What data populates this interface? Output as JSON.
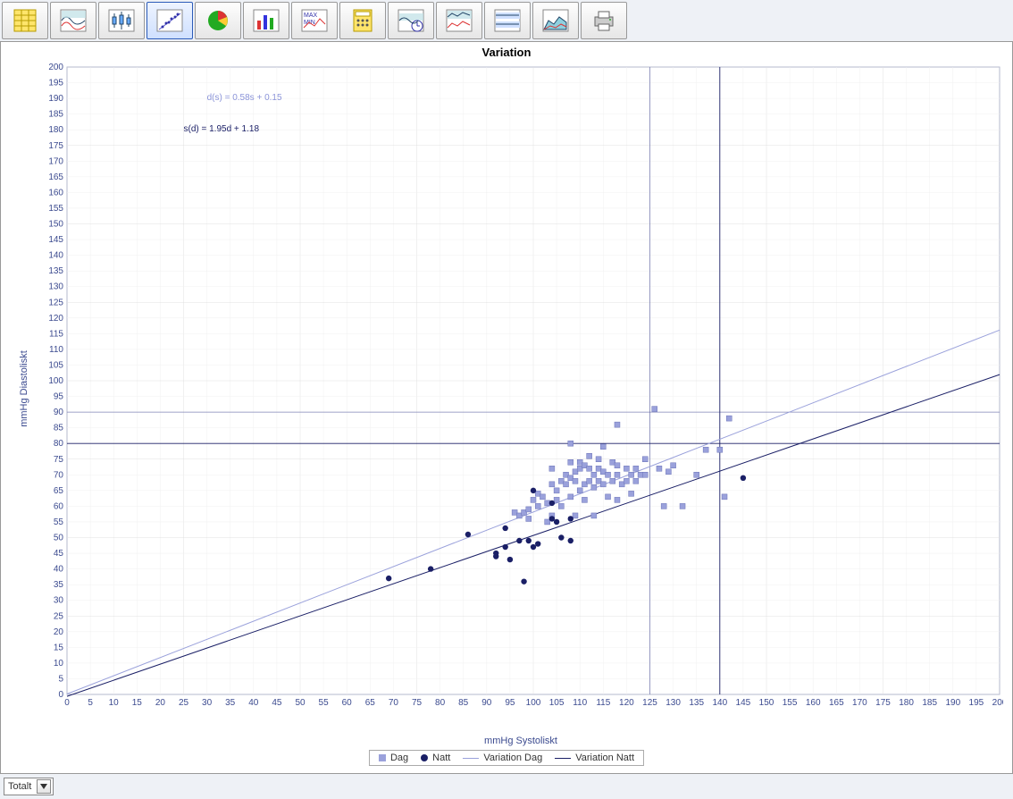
{
  "toolbar": {
    "active_index": 3,
    "buttons": [
      "spreadsheet-icon",
      "waves-icon",
      "box-plot-icon",
      "scatter-icon",
      "pie-icon",
      "bars-icon",
      "max-min-icon",
      "calculator-icon",
      "clock-icon",
      "multi-line-icon",
      "bands-icon",
      "area-icon",
      "printer-icon"
    ]
  },
  "chart_title": "Variation",
  "xlabel": "mmHg Systoliskt",
  "ylabel": "mmHg Diastoliskt",
  "annotation1": "d(s) = 0.58s + 0.15",
  "annotation2": "s(d) = 1.95d + 1.18",
  "legend": {
    "dag": "Dag",
    "natt": "Natt",
    "variation_dag": "Variation Dag",
    "variation_natt": "Variation Natt"
  },
  "bottom_selector": {
    "value": "Totalt"
  },
  "colors": {
    "dag": "#9aa1db",
    "natt": "#1a1f66",
    "line_dag": "#9aa1db",
    "line_natt": "#1a1f66",
    "grid_minor": "#f0f0f0",
    "grid_major": "#e0e0e0",
    "axis": "#3b4a8f",
    "ref": "#52589e"
  },
  "chart_data": {
    "type": "scatter",
    "title": "Variation",
    "xlabel": "mmHg Systoliskt",
    "ylabel": "mmHg Diastoliskt",
    "xlim": [
      0,
      200
    ],
    "ylim": [
      0,
      200
    ],
    "xticks_step": 5,
    "yticks_step": 5,
    "series": [
      {
        "name": "Dag",
        "marker": "square",
        "color": "#9aa1db",
        "points": [
          [
            96,
            58
          ],
          [
            97,
            57
          ],
          [
            98,
            58
          ],
          [
            99,
            56
          ],
          [
            99,
            59
          ],
          [
            100,
            62
          ],
          [
            101,
            64
          ],
          [
            101,
            60
          ],
          [
            102,
            63
          ],
          [
            103,
            55
          ],
          [
            103,
            61
          ],
          [
            104,
            57
          ],
          [
            104,
            67
          ],
          [
            104,
            72
          ],
          [
            105,
            62
          ],
          [
            105,
            65
          ],
          [
            106,
            60
          ],
          [
            106,
            68
          ],
          [
            107,
            67
          ],
          [
            107,
            70
          ],
          [
            108,
            63
          ],
          [
            108,
            69
          ],
          [
            108,
            74
          ],
          [
            108,
            80
          ],
          [
            109,
            57
          ],
          [
            109,
            68
          ],
          [
            109,
            71
          ],
          [
            110,
            65
          ],
          [
            110,
            72
          ],
          [
            110,
            74
          ],
          [
            111,
            62
          ],
          [
            111,
            67
          ],
          [
            111,
            73
          ],
          [
            112,
            68
          ],
          [
            112,
            72
          ],
          [
            112,
            76
          ],
          [
            113,
            57
          ],
          [
            113,
            66
          ],
          [
            113,
            70
          ],
          [
            114,
            68
          ],
          [
            114,
            72
          ],
          [
            114,
            75
          ],
          [
            115,
            67
          ],
          [
            115,
            71
          ],
          [
            115,
            79
          ],
          [
            116,
            63
          ],
          [
            116,
            70
          ],
          [
            117,
            68
          ],
          [
            117,
            74
          ],
          [
            118,
            62
          ],
          [
            118,
            70
          ],
          [
            118,
            73
          ],
          [
            118,
            86
          ],
          [
            119,
            67
          ],
          [
            120,
            68
          ],
          [
            120,
            72
          ],
          [
            121,
            64
          ],
          [
            121,
            70
          ],
          [
            122,
            68
          ],
          [
            122,
            72
          ],
          [
            123,
            70
          ],
          [
            124,
            70
          ],
          [
            124,
            75
          ],
          [
            126,
            91
          ],
          [
            127,
            72
          ],
          [
            128,
            60
          ],
          [
            129,
            71
          ],
          [
            130,
            73
          ],
          [
            132,
            60
          ],
          [
            135,
            70
          ],
          [
            137,
            78
          ],
          [
            140,
            78
          ],
          [
            141,
            63
          ],
          [
            142,
            88
          ]
        ]
      },
      {
        "name": "Natt",
        "marker": "circle",
        "color": "#1a1f66",
        "points": [
          [
            69,
            37
          ],
          [
            78,
            40
          ],
          [
            86,
            51
          ],
          [
            92,
            45
          ],
          [
            92,
            44
          ],
          [
            94,
            47
          ],
          [
            94,
            53
          ],
          [
            95,
            43
          ],
          [
            97,
            49
          ],
          [
            98,
            36
          ],
          [
            99,
            49
          ],
          [
            100,
            47
          ],
          [
            100,
            65
          ],
          [
            101,
            48
          ],
          [
            104,
            56
          ],
          [
            104,
            61
          ],
          [
            105,
            55
          ],
          [
            106,
            50
          ],
          [
            108,
            49
          ],
          [
            108,
            56
          ],
          [
            145,
            69
          ]
        ]
      }
    ],
    "regression_lines": [
      {
        "name": "Variation Dag",
        "label": "d(s) = 0.58s + 0.15",
        "slope": 0.58,
        "intercept": 0.15,
        "color": "#9aa1db"
      },
      {
        "name": "Variation Natt",
        "label": "s(d) = 1.95d + 1.18",
        "slope_inv": 1.95,
        "intercept_inv": 1.18,
        "color": "#1a1f66"
      }
    ],
    "reference_lines": {
      "dag_x": 125,
      "dag_y": 90,
      "natt_x": 140,
      "natt_y": 80
    }
  }
}
